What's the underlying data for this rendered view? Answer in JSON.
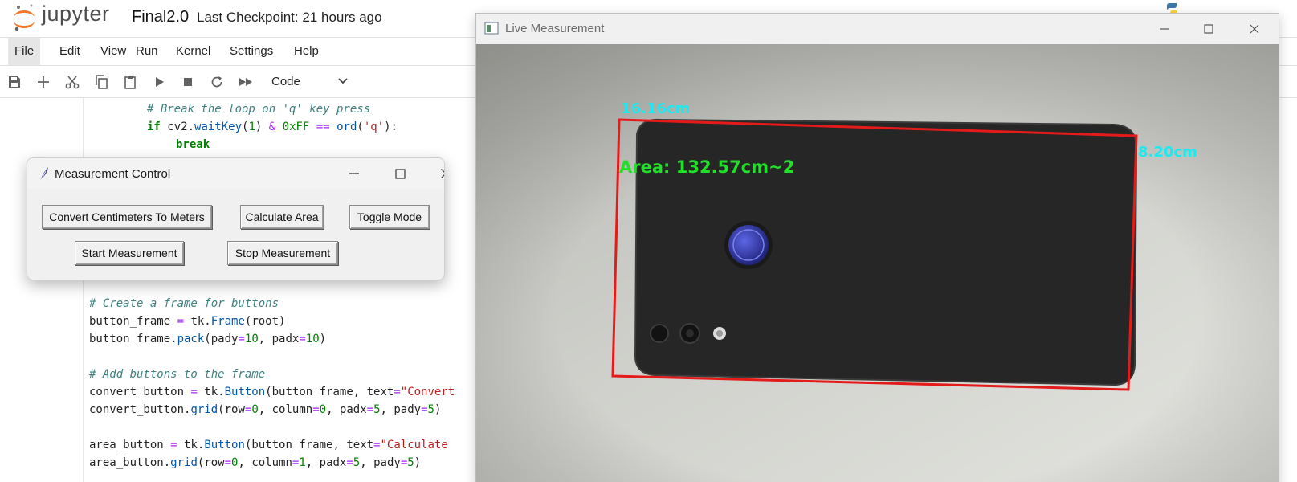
{
  "header": {
    "logo_text": "jupyter",
    "notebook_title": "Final2.0",
    "checkpoint": "Last Checkpoint: 21 hours ago"
  },
  "menu": {
    "items": [
      "File",
      "Edit",
      "View",
      "Run",
      "Kernel",
      "Settings",
      "Help"
    ],
    "active": "File"
  },
  "toolbar": {
    "icons": [
      "save-icon",
      "add-cell-icon",
      "cut-icon",
      "copy-icon",
      "paste-icon",
      "run-icon",
      "stop-icon",
      "restart-icon",
      "fast-forward-icon"
    ],
    "cell_type": "Code"
  },
  "code": {
    "top_lines": [
      "# Break the loop on 'q' key press",
      "if cv2.waitKey(1) & 0xFF == ord('q'):",
      "    break"
    ],
    "lower_lines": [
      "# Create a frame for buttons",
      "button_frame = tk.Frame(root)",
      "button_frame.pack(pady=10, padx=10)",
      "",
      "# Add buttons to the frame",
      "convert_button = tk.Button(button_frame, text=\"Convert",
      "convert_button.grid(row=0, column=0, padx=5, pady=5)",
      "",
      "area_button = tk.Button(button_frame, text=\"Calculate",
      "area_button.grid(row=0, column=1, padx=5, pady=5)"
    ]
  },
  "measurement_control": {
    "title": "Measurement Control",
    "buttons": {
      "convert": "Convert Centimeters To Meters",
      "area": "Calculate Area",
      "toggle": "Toggle Mode",
      "start": "Start Measurement",
      "stop": "Stop Measurement"
    }
  },
  "live_measurement": {
    "title": "Live Measurement",
    "width_label": "16.16cm",
    "height_label": "8.20cm",
    "area_label": "Area: 132.57cm~2",
    "colors": {
      "box": "#e51a1a",
      "dimension_text": "#1fe8ef",
      "area_text": "#22e02a"
    }
  }
}
